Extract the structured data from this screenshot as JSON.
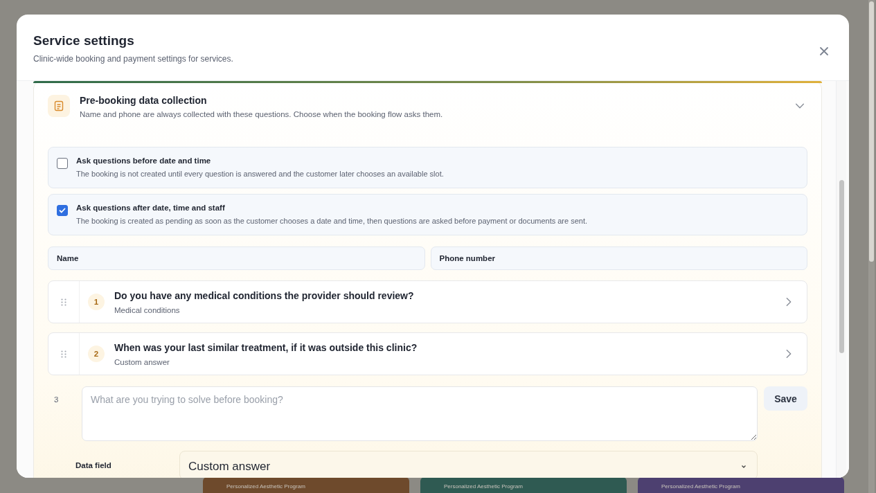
{
  "background": {
    "cards": [
      {
        "subtitle": "Personalized Aesthetic Program",
        "color": "#6e4a2c"
      },
      {
        "subtitle": "Personalized Aesthetic Program",
        "color": "#2f5a52"
      },
      {
        "subtitle": "Personalized Aesthetic Program",
        "color": "#4d4070"
      }
    ]
  },
  "dialog": {
    "title": "Service settings",
    "subtitle": "Clinic-wide booking and payment settings for services.",
    "section": {
      "title": "Pre-booking data collection",
      "description": "Name and phone are always collected with these questions. Choose when the booking flow asks them.",
      "expanded": true,
      "timing_options": [
        {
          "label": "Ask questions before date and time",
          "description": "The booking is not created until every question is answered and the customer later chooses an available slot.",
          "checked": false
        },
        {
          "label": "Ask questions after date, time and staff",
          "description": "The booking is created as pending as soon as the customer chooses a date and time, then questions are asked before payment or documents are sent.",
          "checked": true
        }
      ],
      "fixed_fields": [
        "Name",
        "Phone number"
      ],
      "questions": [
        {
          "number": "1",
          "title": "Do you have any medical conditions the provider should review?",
          "data_field": "Medical conditions"
        },
        {
          "number": "2",
          "title": "When was your last similar treatment, if it was outside this clinic?",
          "data_field": "Custom answer"
        }
      ],
      "new_question": {
        "number": "3",
        "placeholder": "What are you trying to solve before booking?",
        "save": "Save",
        "data_field_label": "Data field",
        "data_field_value": "Custom answer"
      }
    }
  }
}
